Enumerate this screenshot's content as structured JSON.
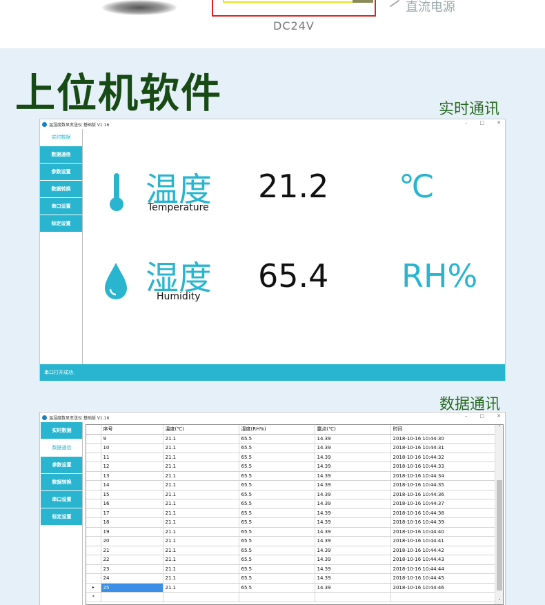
{
  "top": {
    "power_caption": "DC24V",
    "side_caption": "直流电源"
  },
  "title": "上位机软件",
  "sections": {
    "realtime": "实时通讯",
    "data": "数据通讯"
  },
  "app": {
    "window_title": "温湿度数显变送仪 基础版 V1.16",
    "controls": {
      "minimize": "–",
      "maximize": "□",
      "close": "✕"
    },
    "nav": [
      "实时数据",
      "数据通信",
      "参数设置",
      "数据转换",
      "串口设置",
      "标定设置"
    ]
  },
  "monitor": {
    "temperature": {
      "cn": "温度",
      "en": "Temperature",
      "value": "21.2",
      "unit": "℃",
      "icon": "thermometer-icon"
    },
    "humidity": {
      "cn": "湿度",
      "en": "Humidity",
      "value": "65.4",
      "unit": "RH%",
      "icon": "water-drop-icon"
    },
    "status": "串口打开成功."
  },
  "table": {
    "columns": [
      "序号",
      "温度(℃)",
      "湿度(RH%)",
      "露点(℃)",
      "时间"
    ],
    "rows": [
      [
        "9",
        "21.1",
        "65.5",
        "14.39",
        "2018-10-16 10:44:30"
      ],
      [
        "10",
        "21.1",
        "65.5",
        "14.39",
        "2018-10-16 10:44:31"
      ],
      [
        "11",
        "21.1",
        "65.5",
        "14.39",
        "2018-10-16 10:44:32"
      ],
      [
        "12",
        "21.1",
        "65.5",
        "14.39",
        "2018-10-16 10:44:33"
      ],
      [
        "13",
        "21.1",
        "65.5",
        "14.39",
        "2018-10-16 10:44:34"
      ],
      [
        "14",
        "21.1",
        "65.5",
        "14.39",
        "2018-10-16 10:44:35"
      ],
      [
        "15",
        "21.1",
        "65.5",
        "14.39",
        "2018-10-16 10:44:36"
      ],
      [
        "16",
        "21.1",
        "65.5",
        "14.39",
        "2018-10-16 10:44:37"
      ],
      [
        "17",
        "21.1",
        "65.5",
        "14.39",
        "2018-10-16 10:44:38"
      ],
      [
        "18",
        "21.1",
        "65.5",
        "14.39",
        "2018-10-16 10:44:39"
      ],
      [
        "19",
        "21.1",
        "65.5",
        "14.39",
        "2018-10-16 10:44:40"
      ],
      [
        "20",
        "21.1",
        "65.5",
        "14.39",
        "2018-10-16 10:44:41"
      ],
      [
        "21",
        "21.1",
        "65.5",
        "14.39",
        "2018-10-16 10:44:42"
      ],
      [
        "22",
        "21.1",
        "65.5",
        "14.39",
        "2018-10-16 10:44:43"
      ],
      [
        "23",
        "21.1",
        "65.5",
        "14.39",
        "2018-10-16 10:44:44"
      ],
      [
        "24",
        "21.1",
        "65.5",
        "14.39",
        "2018-10-16 10:44:45"
      ],
      [
        "25",
        "21.1",
        "65.5",
        "14.39",
        "2018-10-16 10:44:46"
      ]
    ],
    "selected_row_marker": "▸",
    "new_row_marker": "*"
  },
  "colors": {
    "accent": "#29b5cf",
    "title_green": "#174a14",
    "selection": "#3b8fe6"
  }
}
